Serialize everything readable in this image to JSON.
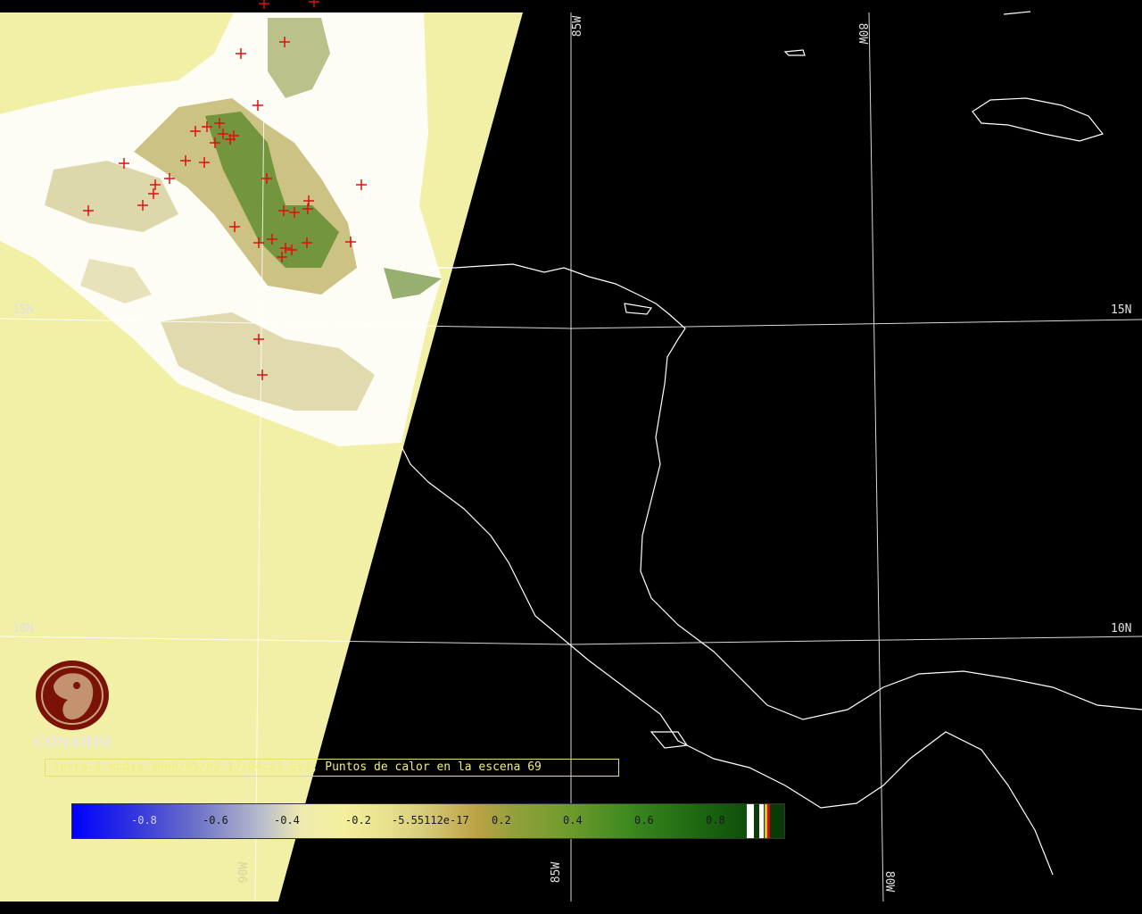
{
  "caption": "terra-1 modis 2006/05/02 17:04:21 EVI, Puntos de calor en la escena 69",
  "logo": {
    "text": "CONABIO",
    "icon": "conabio-macaw-logo-icon"
  },
  "grid_labels": {
    "lat_15": "15N",
    "lat_10": "10N",
    "lon_85": "85W",
    "lon_80": "80W",
    "lon_90": "90W"
  },
  "colorbar": {
    "ticks": [
      "-0.8",
      "-0.6",
      "-0.4",
      "-0.2",
      "-5.55112e-17",
      "0.2",
      "0.4",
      "0.6",
      "0.8"
    ],
    "colors": {
      "low": "#0000ff",
      "mid": "#f4ef9e",
      "high": "#0e4f0a"
    }
  },
  "colors": {
    "land_no_data": "#f2f0a6",
    "outside_scene": "#000000",
    "coastline": "#ffffff",
    "graticule": "#ffffff",
    "hotspot": "#e01010",
    "caption_text": "#f2ee7c"
  },
  "hotspots_count": 69
}
